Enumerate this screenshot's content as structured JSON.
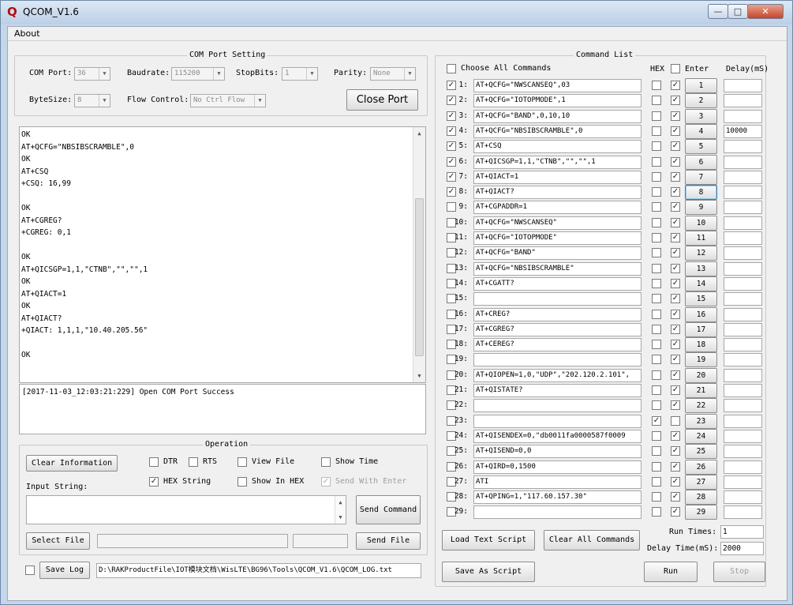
{
  "window": {
    "title": "QCOM_V1.6",
    "logo": "Q",
    "min_glyph": "—",
    "max_glyph": "□",
    "close_glyph": "✕"
  },
  "menu": {
    "about": "About"
  },
  "com_port": {
    "legend": "COM Port Setting",
    "com_port_label": "COM Port:",
    "com_port_value": "36",
    "baudrate_label": "Baudrate:",
    "baudrate_value": "115200",
    "stopbits_label": "StopBits:",
    "stopbits_value": "1",
    "parity_label": "Parity:",
    "parity_value": "None",
    "bytesize_label": "ByteSize:",
    "bytesize_value": "8",
    "flow_label": "Flow Control:",
    "flow_value": "No Ctrl Flow",
    "close_port": "Close Port"
  },
  "receive_lines": [
    "OK",
    "AT+QCFG=\"NBSIBSCRAMBLE\",0",
    "OK",
    "AT+CSQ",
    "+CSQ: 16,99",
    "",
    "OK",
    "AT+CGREG?",
    "+CGREG: 0,1",
    "",
    "OK",
    "AT+QICSGP=1,1,\"CTNB\",\"\",\"\",1",
    "OK",
    "AT+QIACT=1",
    "OK",
    "AT+QIACT?",
    "+QIACT: 1,1,1,\"10.40.205.56\"",
    "",
    "OK"
  ],
  "status_log": "[2017-11-03_12:03:21:229] Open COM Port Success",
  "operation": {
    "legend": "Operation",
    "clear_information": "Clear Information",
    "dtr": "DTR",
    "rts": "RTS",
    "view_file": "View File",
    "show_time": "Show Time",
    "hex_string": "HEX String",
    "show_in_hex": "Show In HEX",
    "send_with_enter": "Send With Enter",
    "input_string_label": "Input String:",
    "send_command": "Send Command",
    "select_file": "Select File",
    "send_file": "Send File",
    "save_log": "Save Log",
    "log_path": "D:\\RAKProductFile\\IOT模块文档\\WisLTE\\BG96\\Tools\\QCOM_V1.6\\QCOM_LOG.txt",
    "hex_checked_mark": "✓"
  },
  "command_list": {
    "legend": "Command List",
    "choose_all": "Choose All Commands",
    "hex_header": "HEX",
    "enter_header": "Enter",
    "delay_header": "Delay(mS)",
    "check_mark": "✓",
    "commands": [
      {
        "num": "1:",
        "cmd": "AT+QCFG=\"NWSCANSEQ\",03",
        "selected": true,
        "hex": false,
        "enter": true,
        "btn": "1",
        "delay": ""
      },
      {
        "num": "2:",
        "cmd": "AT+QCFG=\"IOTOPMODE\",1",
        "selected": true,
        "hex": false,
        "enter": true,
        "btn": "2",
        "delay": ""
      },
      {
        "num": "3:",
        "cmd": "AT+QCFG=\"BAND\",0,10,10",
        "selected": true,
        "hex": false,
        "enter": true,
        "btn": "3",
        "delay": ""
      },
      {
        "num": "4:",
        "cmd": "AT+QCFG=\"NBSIBSCRAMBLE\",0",
        "selected": true,
        "hex": false,
        "enter": true,
        "btn": "4",
        "delay": "10000"
      },
      {
        "num": "5:",
        "cmd": "AT+CSQ",
        "selected": true,
        "hex": false,
        "enter": true,
        "btn": "5",
        "delay": ""
      },
      {
        "num": "6:",
        "cmd": "AT+QICSGP=1,1,\"CTNB\",\"\",\"\",1",
        "selected": true,
        "hex": false,
        "enter": true,
        "btn": "6",
        "delay": ""
      },
      {
        "num": "7:",
        "cmd": "AT+QIACT=1",
        "selected": true,
        "hex": false,
        "enter": true,
        "btn": "7",
        "delay": ""
      },
      {
        "num": "8:",
        "cmd": "AT+QIACT?",
        "selected": true,
        "hex": false,
        "enter": true,
        "btn": "8",
        "delay": ""
      },
      {
        "num": "9:",
        "cmd": "AT+CGPADDR=1",
        "selected": false,
        "hex": false,
        "enter": true,
        "btn": "9",
        "delay": ""
      },
      {
        "num": "10:",
        "cmd": "AT+QCFG=\"NWSCANSEQ\"",
        "selected": false,
        "hex": false,
        "enter": true,
        "btn": "10",
        "delay": ""
      },
      {
        "num": "11:",
        "cmd": "AT+QCFG=\"IOTOPMODE\"",
        "selected": false,
        "hex": false,
        "enter": true,
        "btn": "11",
        "delay": ""
      },
      {
        "num": "12:",
        "cmd": "AT+QCFG=\"BAND\"",
        "selected": false,
        "hex": false,
        "enter": true,
        "btn": "12",
        "delay": ""
      },
      {
        "num": "13:",
        "cmd": "AT+QCFG=\"NBSIBSCRAMBLE\"",
        "selected": false,
        "hex": false,
        "enter": true,
        "btn": "13",
        "delay": ""
      },
      {
        "num": "14:",
        "cmd": "AT+CGATT?",
        "selected": false,
        "hex": false,
        "enter": true,
        "btn": "14",
        "delay": ""
      },
      {
        "num": "15:",
        "cmd": "",
        "selected": false,
        "hex": false,
        "enter": true,
        "btn": "15",
        "delay": ""
      },
      {
        "num": "16:",
        "cmd": "AT+CREG?",
        "selected": false,
        "hex": false,
        "enter": true,
        "btn": "16",
        "delay": ""
      },
      {
        "num": "17:",
        "cmd": "AT+CGREG?",
        "selected": false,
        "hex": false,
        "enter": true,
        "btn": "17",
        "delay": ""
      },
      {
        "num": "18:",
        "cmd": "AT+CEREG?",
        "selected": false,
        "hex": false,
        "enter": true,
        "btn": "18",
        "delay": ""
      },
      {
        "num": "19:",
        "cmd": "",
        "selected": false,
        "hex": false,
        "enter": true,
        "btn": "19",
        "delay": ""
      },
      {
        "num": "20:",
        "cmd": "AT+QIOPEN=1,0,\"UDP\",\"202.120.2.101\",",
        "selected": false,
        "hex": false,
        "enter": true,
        "btn": "20",
        "delay": ""
      },
      {
        "num": "21:",
        "cmd": "AT+QISTATE?",
        "selected": false,
        "hex": false,
        "enter": true,
        "btn": "21",
        "delay": ""
      },
      {
        "num": "22:",
        "cmd": "",
        "selected": false,
        "hex": false,
        "enter": true,
        "btn": "22",
        "delay": ""
      },
      {
        "num": "23:",
        "cmd": "",
        "selected": false,
        "hex": true,
        "enter": false,
        "btn": "23",
        "delay": ""
      },
      {
        "num": "24:",
        "cmd": "AT+QISENDEX=0,\"db0011fa0000587f0009",
        "selected": false,
        "hex": false,
        "enter": true,
        "btn": "24",
        "delay": ""
      },
      {
        "num": "25:",
        "cmd": "AT+QISEND=0,0",
        "selected": false,
        "hex": false,
        "enter": true,
        "btn": "25",
        "delay": ""
      },
      {
        "num": "26:",
        "cmd": "AT+QIRD=0,1500",
        "selected": false,
        "hex": false,
        "enter": true,
        "btn": "26",
        "delay": ""
      },
      {
        "num": "27:",
        "cmd": "ATI",
        "selected": false,
        "hex": false,
        "enter": true,
        "btn": "27",
        "delay": ""
      },
      {
        "num": "28:",
        "cmd": "AT+QPING=1,\"117.60.157.30\"",
        "selected": false,
        "hex": false,
        "enter": true,
        "btn": "28",
        "delay": ""
      },
      {
        "num": "29:",
        "cmd": "",
        "selected": false,
        "hex": false,
        "enter": true,
        "btn": "29",
        "delay": ""
      }
    ],
    "load_text_script": "Load Text Script",
    "clear_all_commands": "Clear All Commands",
    "save_as_script": "Save As Script",
    "run_times_label": "Run Times:",
    "run_times_value": "1",
    "delay_time_label": "Delay Time(mS):",
    "delay_time_value": "2000",
    "run": "Run",
    "stop": "Stop"
  }
}
